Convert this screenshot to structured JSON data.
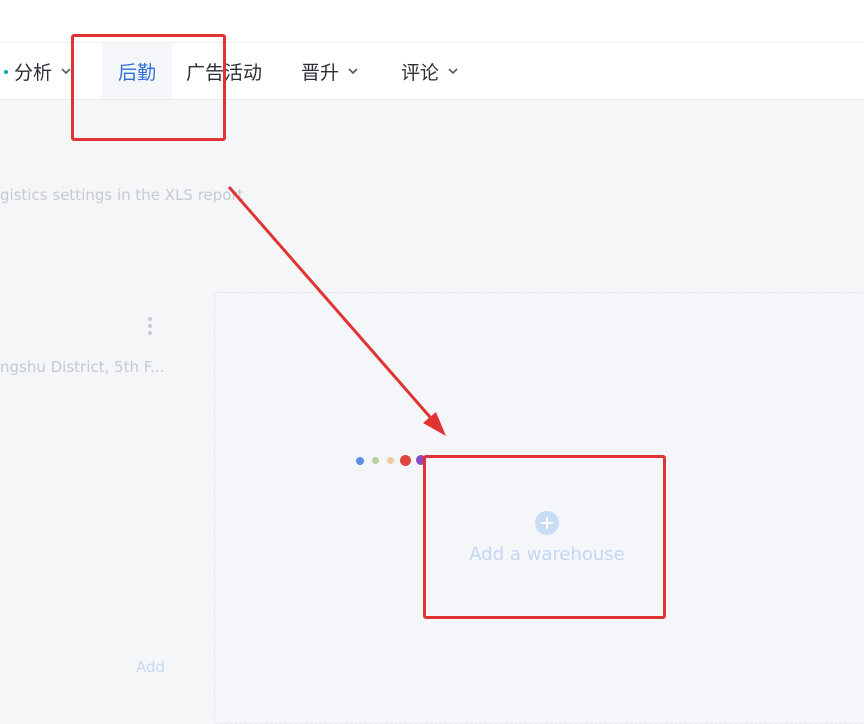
{
  "nav": {
    "items": [
      {
        "label": "分析",
        "has_caret": true
      },
      {
        "label": "后勤",
        "has_caret": false,
        "active": true
      },
      {
        "label": "广告活动",
        "has_caret": false
      },
      {
        "label": "晋升",
        "has_caret": true
      },
      {
        "label": "评论",
        "has_caret": true
      }
    ]
  },
  "content": {
    "description": "gistics settings in the XLS report",
    "warehouse_card": {
      "address": "ngshu District, 5th F...",
      "add_label": "Add"
    },
    "add_warehouse": {
      "label": "Add a warehouse",
      "icon": "plus-circle-icon"
    }
  },
  "colors": {
    "active_nav": "#2f6fd6",
    "annotation": "#e23333",
    "loader_dots": [
      "#5a8fe6",
      "#b6d29a",
      "#f0c9a0",
      "#e0463e",
      "#8c4bc0"
    ]
  }
}
